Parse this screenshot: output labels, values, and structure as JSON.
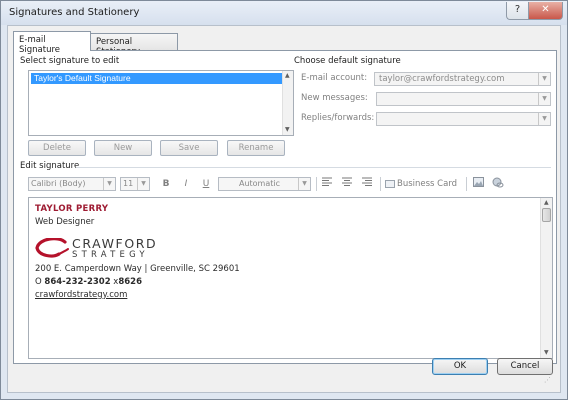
{
  "window": {
    "title": "Signatures and Stationery",
    "help_label": "?",
    "close_label": "✕"
  },
  "tabs": [
    {
      "label": "E-mail Signature",
      "active": true
    },
    {
      "label": "Personal Stationery",
      "active": false
    }
  ],
  "select_section": {
    "label": "Select signature to edit",
    "items": [
      "Taylor's Default Signature"
    ]
  },
  "signature_buttons": [
    "Delete",
    "New",
    "Save",
    "Rename"
  ],
  "default_section": {
    "label": "Choose default signature",
    "email_account_label": "E-mail account:",
    "email_account_value": "taylor@crawfordstrategy.com",
    "new_messages_label": "New messages:",
    "new_messages_value": "",
    "replies_label": "Replies/forwards:",
    "replies_value": ""
  },
  "edit_section": {
    "label": "Edit signature",
    "font_value": "Calibri (Body)",
    "size_value": "11",
    "bold_label": "B",
    "italic_label": "I",
    "underline_label": "U",
    "color_value": "Automatic",
    "business_card_label": "Business Card"
  },
  "signature": {
    "name": "TAYLOR PERRY",
    "role": "Web Designer",
    "logo_text_1": "CRAWFORD",
    "logo_text_2": "STRATEGY",
    "address": "200 E. Camperdown Way | Greenville, SC 29601",
    "phone_prefix": "O ",
    "phone_main": "864-232-2302",
    "phone_ext_prefix": " x",
    "phone_ext": "8626",
    "website": "crawfordstrategy.com",
    "name_color": "#9e1b32",
    "logo_color": "#b5122b"
  },
  "footer": {
    "ok_label": "OK",
    "cancel_label": "Cancel"
  }
}
